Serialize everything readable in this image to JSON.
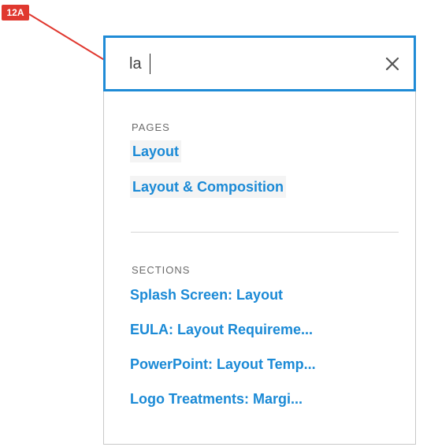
{
  "annotation": {
    "badge": "12A",
    "color": "#e0382f"
  },
  "search": {
    "value": "la",
    "focus_color": "#1f8bd6"
  },
  "pages": {
    "label": "PAGES",
    "items": [
      "Layout",
      "Layout & Composition"
    ]
  },
  "sections": {
    "label": "SECTIONS",
    "items": [
      "Splash Screen: Layout",
      "EULA: Layout Requireme...",
      "PowerPoint: Layout Temp...",
      "Logo Treatments: Margi..."
    ]
  },
  "link_color": "#1b8ad6"
}
